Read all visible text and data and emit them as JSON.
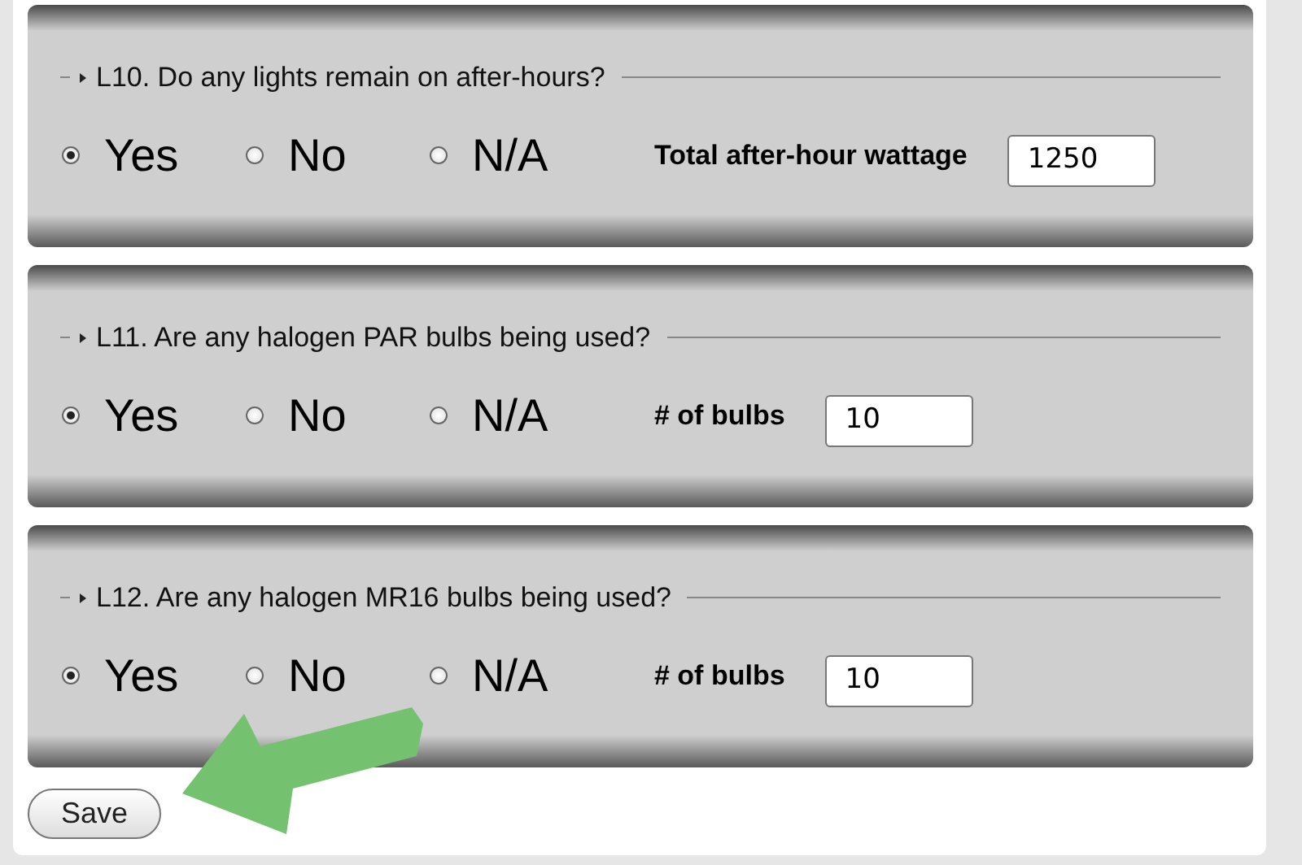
{
  "questions": [
    {
      "legend": "L10. Do any lights remain on after-hours?",
      "options": [
        {
          "label": "Yes",
          "selected": true
        },
        {
          "label": "No",
          "selected": false
        },
        {
          "label": "N/A",
          "selected": false
        }
      ],
      "field_label": "Total after-hour wattage",
      "field_value": "1250"
    },
    {
      "legend": "L11. Are any halogen PAR bulbs being used?",
      "options": [
        {
          "label": "Yes",
          "selected": true
        },
        {
          "label": "No",
          "selected": false
        },
        {
          "label": "N/A",
          "selected": false
        }
      ],
      "field_label": "# of bulbs",
      "field_value": "10"
    },
    {
      "legend": "L12. Are any halogen MR16 bulbs being used?",
      "options": [
        {
          "label": "Yes",
          "selected": true
        },
        {
          "label": "No",
          "selected": false
        },
        {
          "label": "N/A",
          "selected": false
        }
      ],
      "field_label": "# of bulbs",
      "field_value": "10"
    }
  ],
  "save_button": "Save"
}
